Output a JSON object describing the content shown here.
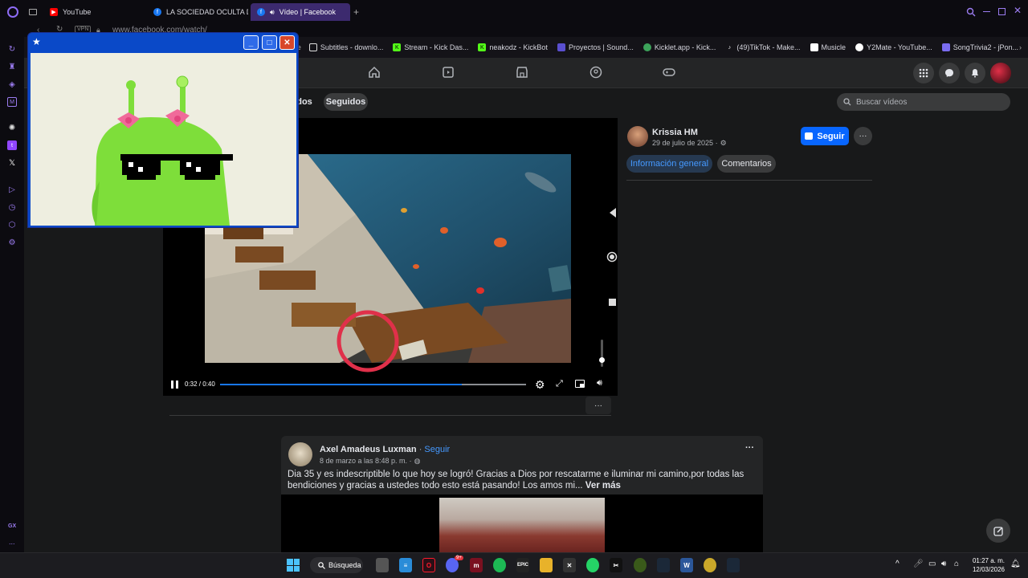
{
  "browser": {
    "tabs": [
      {
        "label": "YouTube",
        "active": false
      },
      {
        "label": "LA SOCIEDAD OCULTA DE",
        "active": false
      },
      {
        "label": "Vídeo | Facebook",
        "active": true
      }
    ],
    "new_tab_label": "+",
    "address": {
      "vpn_badge": "VPN",
      "url": "www.facebook.com/watch/"
    },
    "bookmarks": [
      {
        "label": "Subtitles - downlo...",
        "color": "#ffffff"
      },
      {
        "label": "Stream - Kick Das...",
        "color": "#53fc18"
      },
      {
        "label": "neakodz - KickBot",
        "color": "#53fc18"
      },
      {
        "label": "Proyectos | Sound...",
        "color": "#5a4fcf"
      },
      {
        "label": "Kicklet.app - Kick...",
        "color": "#3ca35a"
      },
      {
        "label": "(49)TikTok - Make...",
        "color": "#ffffff"
      },
      {
        "label": "Musicle",
        "color": "#ffffff"
      },
      {
        "label": "Y2Mate - YouTube...",
        "color": "#ffffff"
      },
      {
        "label": "SongTrivia2 - jPon...",
        "color": "#7a6cf0"
      }
    ],
    "sidebar_label": "GX",
    "sidebar_more": "..."
  },
  "popup_window": {
    "title_icon": "★",
    "buttons": {
      "minimize": "_",
      "maximize": "□",
      "close": "✕"
    }
  },
  "facebook": {
    "filter_chips": [
      "dos",
      "Seguidos"
    ],
    "search": {
      "placeholder": "Buscar vídeos"
    },
    "video": {
      "time": "0:32 / 0:40",
      "progress": 0.79
    },
    "more_button": "···",
    "author": {
      "name": "Krissia HM",
      "date": "29 de julio de 2025 ·"
    },
    "follow_button": "Seguir",
    "tabs": {
      "overview": "Información general",
      "comments": "Comentarios"
    },
    "post": {
      "author": "Axel Amadeus Luxman",
      "separator": " · ",
      "follow": "Seguir",
      "date": "8 de marzo a las 8:48 p. m. ·",
      "text": "Dia 35 y es indescriptible lo que hoy se logró! Gracias a Dios por rescatarme e iluminar mi camino,por todas las bendiciones y gracias a ustedes todo esto está pasando! Los amos mi...",
      "see_more": "Ver más",
      "menu": "···"
    }
  },
  "taskbar": {
    "search_label": "Búsqueda",
    "badge": "9+",
    "clock_time": "01:27 a. m.",
    "clock_date": "12/03/2026",
    "tray_chevron": "^"
  },
  "colors": {
    "fb_blue": "#0866ff",
    "opera_red": "#ff1b2d",
    "purple": "#9b7cf0"
  }
}
